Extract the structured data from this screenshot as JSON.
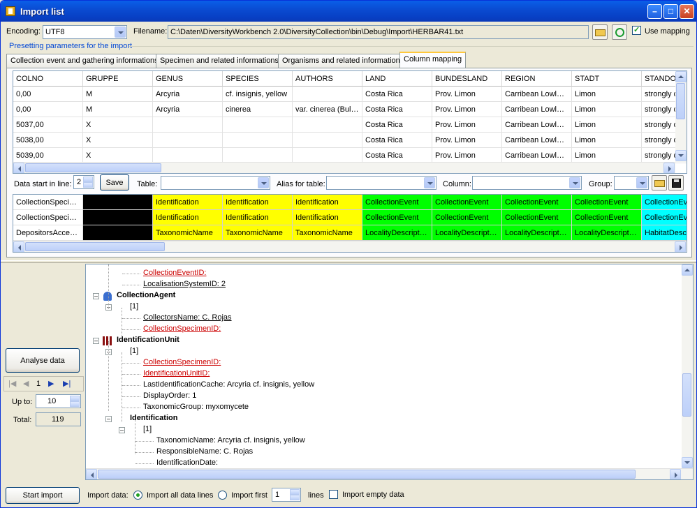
{
  "window": {
    "title": "Import list"
  },
  "top": {
    "encoding_label": "Encoding:",
    "encoding_value": "UTF8",
    "filename_label": "Filename:",
    "filename_value": "C:\\Daten\\DiversityWorkbench 2.0\\DiversityCollection\\bin\\Debug\\Import\\HERBAR41.txt",
    "use_mapping_label": "Use mapping",
    "use_mapping_checked": true,
    "presetting_label": "Presetting parameters for the import"
  },
  "tabs": [
    {
      "label": "Collection event and gathering informations"
    },
    {
      "label": "Specimen and related informations"
    },
    {
      "label": "Organisms and related informations"
    },
    {
      "label": "Column mapping"
    }
  ],
  "data_grid": {
    "columns": [
      "COLNO",
      "GRUPPE",
      "GENUS",
      "SPECIES",
      "AUTHORS",
      "LAND",
      "BUNDESLAND",
      "REGION",
      "STADT",
      "STANDO"
    ],
    "rows": [
      [
        "0,00",
        "M",
        "Arcyria",
        "cf. insignis, yellow",
        "",
        "Costa Rica",
        "Prov. Limon",
        "Carribean Lowlan...",
        "Limon",
        "strongly d"
      ],
      [
        "0,00",
        "M",
        "Arcyria",
        "cinerea",
        "var. cinerea (Bull....",
        "Costa Rica",
        "Prov. Limon",
        "Carribean Lowlan...",
        "Limon",
        "strongly d"
      ],
      [
        "5037,00",
        "X",
        "",
        "",
        "",
        "Costa Rica",
        "Prov. Limon",
        "Carribean Lowlan...",
        "Limon",
        "strongly d"
      ],
      [
        "5038,00",
        "X",
        "",
        "",
        "",
        "Costa Rica",
        "Prov. Limon",
        "Carribean Lowlan...",
        "Limon",
        "strongly d"
      ],
      [
        "5039,00",
        "X",
        "",
        "",
        "",
        "Costa Rica",
        "Prov. Limon",
        "Carribean Lowlan...",
        "Limon",
        "strongly d"
      ]
    ]
  },
  "mapping_controls": {
    "data_start_label": "Data start in line:",
    "data_start_value": "2",
    "save_label": "Save",
    "table_label": "Table:",
    "alias_label": "Alias for table:",
    "column_label": "Column:",
    "group_label": "Group:"
  },
  "mapping_grid": {
    "rows": [
      [
        "CollectionSpecim...",
        "",
        "Identification",
        "Identification",
        "Identification",
        "CollectionEvent",
        "CollectionEvent",
        "CollectionEvent",
        "CollectionEvent",
        "CollectionEv"
      ],
      [
        "CollectionSpecim...",
        "",
        "Identification",
        "Identification",
        "Identification",
        "CollectionEvent",
        "CollectionEvent",
        "CollectionEvent",
        "CollectionEvent",
        "CollectionEv"
      ],
      [
        "DepositorsAcces...",
        "",
        "TaxonomicName",
        "TaxonomicName",
        "TaxonomicName",
        "LocalityDescription",
        "LocalityDescription",
        "LocalityDescription",
        "LocalityDescription",
        "HabitatDesc"
      ]
    ],
    "colors": {
      "black": "#000000",
      "yellow": "#ffff00",
      "green": "#00ff00",
      "cyan": "#00ffff"
    }
  },
  "left_panel": {
    "analyse_label": "Analyse data",
    "page_value": "1",
    "up_to_label": "Up to:",
    "up_to_value": "10",
    "total_label": "Total:",
    "total_value": "119"
  },
  "tree": {
    "nodes": [
      {
        "text": "CollectionEventID:"
      },
      {
        "text": "LocalisationSystemID: 2"
      },
      {
        "text": "CollectionAgent"
      },
      {
        "text": "[1]"
      },
      {
        "text": "CollectorsName: C. Rojas"
      },
      {
        "text": "CollectionSpecimenID:"
      },
      {
        "text": "IdentificationUnit"
      },
      {
        "text": "[1]"
      },
      {
        "text": "CollectionSpecimenID:"
      },
      {
        "text": "IdentificationUnitID:"
      },
      {
        "text": "LastIdentificationCache: Arcyria cf. insignis, yellow"
      },
      {
        "text": "DisplayOrder: 1"
      },
      {
        "text": "TaxonomicGroup: myxomycete"
      },
      {
        "text": "Identification"
      },
      {
        "text": "[1]"
      },
      {
        "text": "TaxonomicName: Arcyria cf. insignis, yellow"
      },
      {
        "text": "ResponsibleName: C. Rojas"
      },
      {
        "text": "IdentificationDate:"
      }
    ]
  },
  "bottom": {
    "start_import_label": "Start import",
    "import_data_label": "Import data:",
    "import_all_label": "Import all data lines",
    "import_first_label": "Import first",
    "import_first_value": "1",
    "lines_label": "lines",
    "import_empty_label": "Import empty data",
    "import_all_selected": true,
    "import_empty_checked": false
  }
}
